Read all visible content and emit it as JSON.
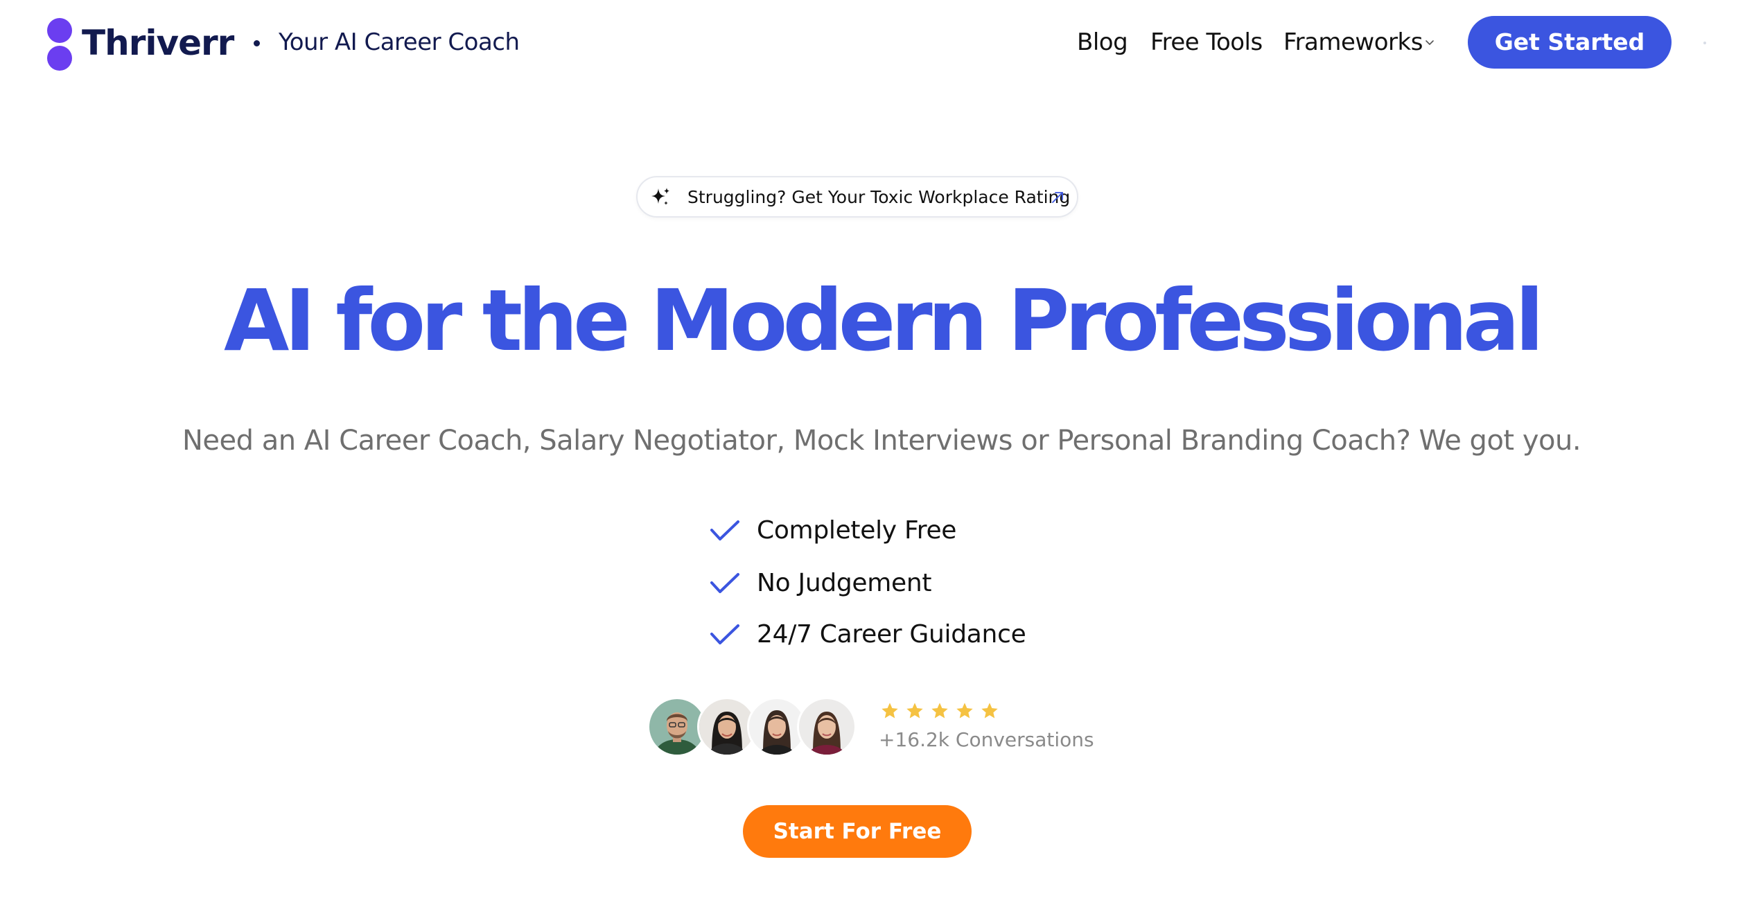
{
  "header": {
    "brand": "Thriverr",
    "tagline": "Your AI Career Coach",
    "nav": {
      "blog": "Blog",
      "free_tools": "Free Tools",
      "frameworks": "Frameworks"
    },
    "cta_label": "Get Started"
  },
  "promo": {
    "text": "Struggling? Get Your Toxic Workplace Rating",
    "icon": "sparkle-icon"
  },
  "hero": {
    "title": "AI for the Modern Professional",
    "subtitle": "Need an AI Career Coach, Salary Negotiator, Mock Interviews or Personal Branding Coach? We got you."
  },
  "features": [
    "Completely Free",
    "No Judgement",
    "24/7 Career Guidance"
  ],
  "social_proof": {
    "rating_stars": 5,
    "conversations": "+16.2k Conversations",
    "avatar_count": 4
  },
  "cta": {
    "label": "Start For Free"
  },
  "colors": {
    "brand_blue": "#3b55e0",
    "brand_purple": "#6b3ef0",
    "navy": "#121a4f",
    "orange": "#ff7a0d",
    "star_yellow": "#f5c242",
    "muted_text": "#6f6f6f"
  }
}
